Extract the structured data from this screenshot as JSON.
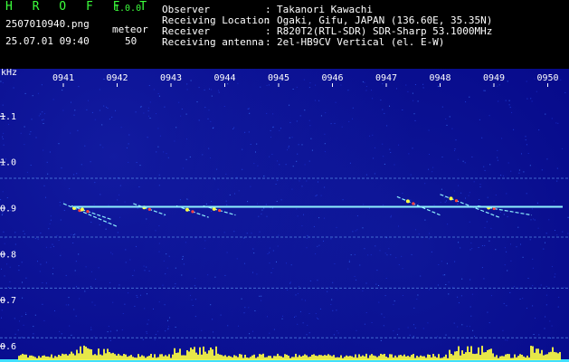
{
  "header": {
    "app_name": "H R O F F T",
    "app_version": "1.0.0",
    "filename": "2507010940.png",
    "datetime": "25.07.01 09:40",
    "meteor_label": "meteor",
    "meteor_count": "50",
    "info": [
      {
        "label": "Observer",
        "value": "Takanori Kawachi"
      },
      {
        "label": "Receiving Location",
        "value": "Ogaki, Gifu, JAPAN (136.60E, 35.35N)"
      },
      {
        "label": "Receiver",
        "value": "R820T2(RTL-SDR) SDR-Sharp 53.1000MHz"
      },
      {
        "label": "Receiving antenna",
        "value": "2el-HB9CV Vertical (el. E-W)"
      }
    ]
  },
  "colors": {
    "background": "#06098a",
    "header_green": "#3cff3c",
    "signal_cyan": "#8ff0ff",
    "meteor_yellow": "#ffff40",
    "meteor_red": "#ff4040"
  },
  "chart_data": {
    "type": "heatmap",
    "ylabel": "kHz",
    "yticks": [
      "1.1",
      "1.0",
      "0.9",
      "0.8",
      "0.7",
      "0.6"
    ],
    "ylim": [
      0.58,
      1.2
    ],
    "xticks": [
      "0941",
      "0942",
      "0943",
      "0944",
      "0945",
      "0946",
      "0947",
      "0948",
      "0949",
      "0950"
    ],
    "carrier_khz": 0.903,
    "horizontal_lines_khz": [
      0.965,
      0.837,
      0.726,
      0.618
    ],
    "meteor_traces": [
      {
        "start_min": 0.0,
        "end_min": 1.0,
        "start_khz": 0.91,
        "end_khz": 0.86
      },
      {
        "start_min": 0.15,
        "end_min": 0.9,
        "start_khz": 0.905,
        "end_khz": 0.875
      },
      {
        "start_min": 1.3,
        "end_min": 1.9,
        "start_khz": 0.91,
        "end_khz": 0.885
      },
      {
        "start_min": 2.1,
        "end_min": 2.7,
        "start_khz": 0.905,
        "end_khz": 0.88
      },
      {
        "start_min": 2.6,
        "end_min": 3.2,
        "start_khz": 0.905,
        "end_khz": 0.885
      },
      {
        "start_min": 6.2,
        "end_min": 7.0,
        "start_khz": 0.925,
        "end_khz": 0.885
      },
      {
        "start_min": 7.0,
        "end_min": 8.1,
        "start_khz": 0.93,
        "end_khz": 0.88
      },
      {
        "start_min": 7.7,
        "end_min": 8.7,
        "start_khz": 0.905,
        "end_khz": 0.885
      }
    ],
    "grid": false
  }
}
